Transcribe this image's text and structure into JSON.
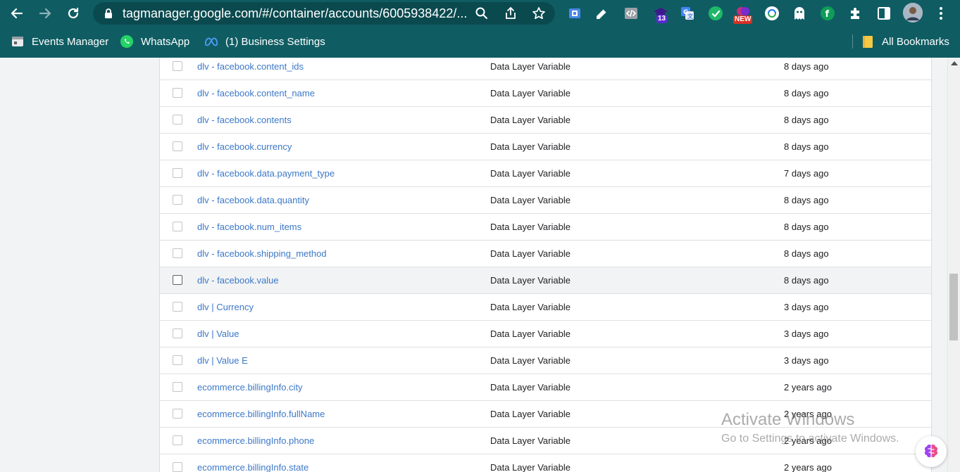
{
  "browser": {
    "url": "tagmanager.google.com/#/container/accounts/6005938422/...",
    "nav": {
      "back_icon": "arrow-left-icon",
      "forward_icon": "arrow-right-icon",
      "reload_icon": "reload-icon"
    },
    "extensions": [
      {
        "name": "extension-blue-icon"
      },
      {
        "name": "extension-pen-icon"
      },
      {
        "name": "extension-code-icon"
      },
      {
        "name": "extension-graduation-icon",
        "badge": "13"
      },
      {
        "name": "google-translate-icon"
      },
      {
        "name": "extension-green-circle-icon"
      },
      {
        "name": "extension-new-icon",
        "badge": "NEW"
      },
      {
        "name": "extension-swirl-icon"
      },
      {
        "name": "extension-ghost-icon"
      },
      {
        "name": "extension-green-f-icon"
      },
      {
        "name": "extensions-puzzle-icon"
      },
      {
        "name": "side-panel-icon"
      },
      {
        "name": "profile-avatar"
      },
      {
        "name": "kebab-menu-icon"
      }
    ],
    "bookmarks": [
      {
        "label": "Events Manager",
        "icon": "events-manager-icon"
      },
      {
        "label": "WhatsApp",
        "icon": "whatsapp-icon"
      },
      {
        "label": "(1) Business Settings",
        "icon": "meta-icon"
      }
    ],
    "all_bookmarks": {
      "label": "All Bookmarks",
      "icon": "folder-icon"
    }
  },
  "variables": {
    "rows": [
      {
        "name": "dlv - facebook.content_ids",
        "type": "Data Layer Variable",
        "edited": "8 days ago"
      },
      {
        "name": "dlv - facebook.content_name",
        "type": "Data Layer Variable",
        "edited": "8 days ago"
      },
      {
        "name": "dlv - facebook.contents",
        "type": "Data Layer Variable",
        "edited": "8 days ago"
      },
      {
        "name": "dlv - facebook.currency",
        "type": "Data Layer Variable",
        "edited": "8 days ago"
      },
      {
        "name": "dlv - facebook.data.payment_type",
        "type": "Data Layer Variable",
        "edited": "7 days ago"
      },
      {
        "name": "dlv - facebook.data.quantity",
        "type": "Data Layer Variable",
        "edited": "8 days ago"
      },
      {
        "name": "dlv - facebook.num_items",
        "type": "Data Layer Variable",
        "edited": "8 days ago"
      },
      {
        "name": "dlv - facebook.shipping_method",
        "type": "Data Layer Variable",
        "edited": "8 days ago"
      },
      {
        "name": "dlv - facebook.value",
        "type": "Data Layer Variable",
        "edited": "8 days ago",
        "hover": true
      },
      {
        "name": "dlv | Currency",
        "type": "Data Layer Variable",
        "edited": "3 days ago"
      },
      {
        "name": "dlv | Value",
        "type": "Data Layer Variable",
        "edited": "3 days ago"
      },
      {
        "name": "dlv | Value E",
        "type": "Data Layer Variable",
        "edited": "3 days ago"
      },
      {
        "name": "ecommerce.billingInfo.city",
        "type": "Data Layer Variable",
        "edited": "2 years ago"
      },
      {
        "name": "ecommerce.billingInfo.fullName",
        "type": "Data Layer Variable",
        "edited": "2 years ago"
      },
      {
        "name": "ecommerce.billingInfo.phone",
        "type": "Data Layer Variable",
        "edited": "2 years ago"
      },
      {
        "name": "ecommerce.billingInfo.state",
        "type": "Data Layer Variable",
        "edited": "2 years ago"
      }
    ]
  },
  "watermark": {
    "title": "Activate Windows",
    "subtitle": "Go to Settings to activate Windows."
  },
  "colors": {
    "chrome": "#0f5d63",
    "link": "#3c78c8",
    "hover_row": "#f1f3f4"
  }
}
